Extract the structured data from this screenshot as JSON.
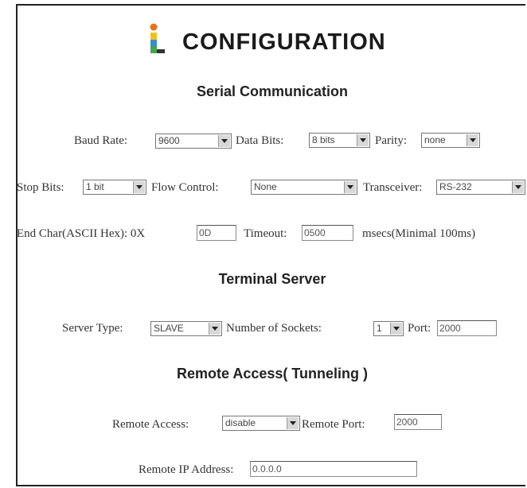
{
  "header": {
    "title": "CONFIGURATION",
    "logo_icon": "info-bar-logo-icon"
  },
  "serial": {
    "heading": "Serial Communication",
    "baud_rate": {
      "label": "Baud Rate:",
      "value": "9600"
    },
    "data_bits": {
      "label": "Data Bits:",
      "value": "8 bits"
    },
    "parity": {
      "label": "Parity:",
      "value": "none"
    },
    "stop_bits": {
      "label": "Stop Bits:",
      "value": "1 bit"
    },
    "flow_control": {
      "label": "Flow Control:",
      "value": "None"
    },
    "transceiver": {
      "label": "Transceiver:",
      "value": "RS-232"
    },
    "end_char": {
      "label": "End Char(ASCII Hex): 0X",
      "value": "0D"
    },
    "timeout": {
      "label": "Timeout:",
      "value": "0500",
      "suffix": "msecs(Minimal 100ms)"
    }
  },
  "terminal": {
    "heading": "Terminal Server",
    "server_type": {
      "label": "Server Type:",
      "value": "SLAVE"
    },
    "sockets": {
      "label": "Number of Sockets:",
      "value": "1"
    },
    "port": {
      "label": "Port:",
      "value": "2000"
    }
  },
  "remote": {
    "heading": "Remote Access( Tunneling )",
    "access": {
      "label": "Remote Access:",
      "value": "disable"
    },
    "port": {
      "label": "Remote Port:",
      "value": "2000"
    },
    "ip": {
      "label": "Remote IP Address:",
      "value": "0.0.0.0"
    }
  }
}
